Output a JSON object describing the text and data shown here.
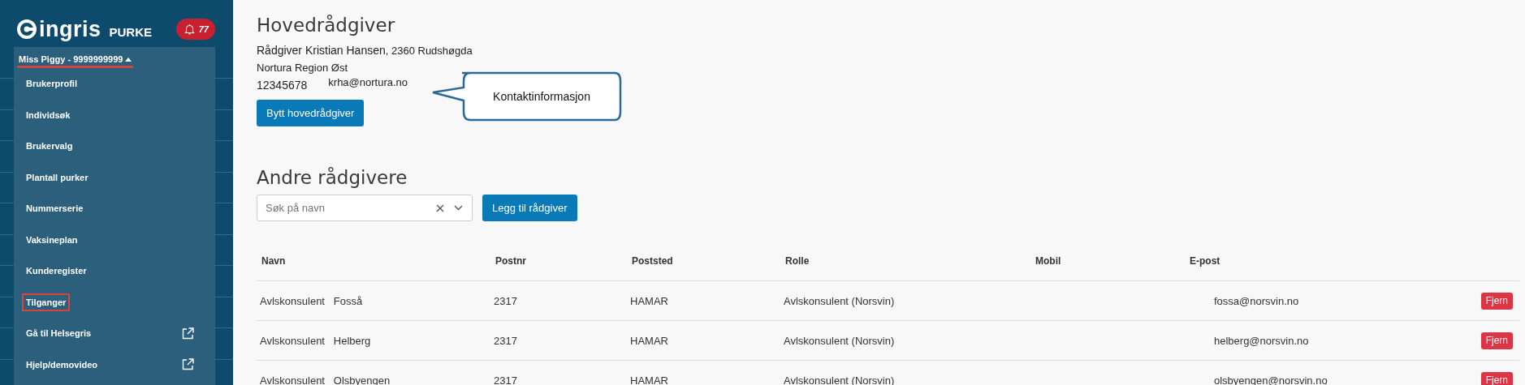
{
  "sidebar": {
    "logo": {
      "brand": "ingris",
      "product": "PURKE"
    },
    "notifications": {
      "count": "77"
    },
    "user_menu": {
      "label": "Miss Piggy -  9999999999",
      "expanded": true,
      "items": [
        {
          "label": "Brukerprofil",
          "selected": false,
          "external": false
        },
        {
          "label": "Individsøk",
          "selected": false,
          "external": false
        },
        {
          "label": "Brukervalg",
          "selected": false,
          "external": false
        },
        {
          "label": "Plantall purker",
          "selected": false,
          "external": false
        },
        {
          "label": "Nummerserie",
          "selected": false,
          "external": false
        },
        {
          "label": "Vaksineplan",
          "selected": false,
          "external": false
        },
        {
          "label": "Kunderegister",
          "selected": false,
          "external": false
        },
        {
          "label": "Tilganger",
          "selected": true,
          "external": false
        },
        {
          "label": "Gå til Helsegris",
          "selected": false,
          "external": true
        },
        {
          "label": "Hjelp/demovideo",
          "selected": false,
          "external": true
        }
      ]
    }
  },
  "main_advisor": {
    "title": "Hovedrådgiver",
    "name": "Rådgiver Kristian Hansen",
    "address": ", 2360 Rudshøgda",
    "organization": "Nortura Region Øst",
    "phone": "12345678",
    "email": "krha@nortura.no",
    "button": "Bytt hovedrådgiver",
    "callout": "Kontaktinformasjon"
  },
  "other_advisors": {
    "title": "Andre rådgivere",
    "search": {
      "placeholder": "Søk på navn"
    },
    "add_button": "Legg til rådgiver",
    "table": {
      "columns": [
        "Navn",
        "Postnr",
        "Poststed",
        "Rolle",
        "Mobil",
        "E-post"
      ],
      "rows": [
        {
          "name": "Avlskonsulent   Fosså",
          "postnr": "2317",
          "poststed": "HAMAR",
          "rolle": "Avlskonsulent (Norsvin)",
          "email": "fossa@norsvin.no",
          "action": "Fjern"
        },
        {
          "name": "Avlskonsulent   Helberg",
          "postnr": "2317",
          "poststed": "HAMAR",
          "rolle": "Avlskonsulent (Norsvin)",
          "email": "helberg@norsvin.no",
          "action": "Fjern"
        },
        {
          "name": "Avlskonsulent   Olsbyengen",
          "postnr": "2317",
          "poststed": "HAMAR",
          "rolle": "Avlskonsulent (Norsvin)",
          "email": "olsbyengen@norsvin.no",
          "action": "Fjern"
        }
      ]
    }
  }
}
